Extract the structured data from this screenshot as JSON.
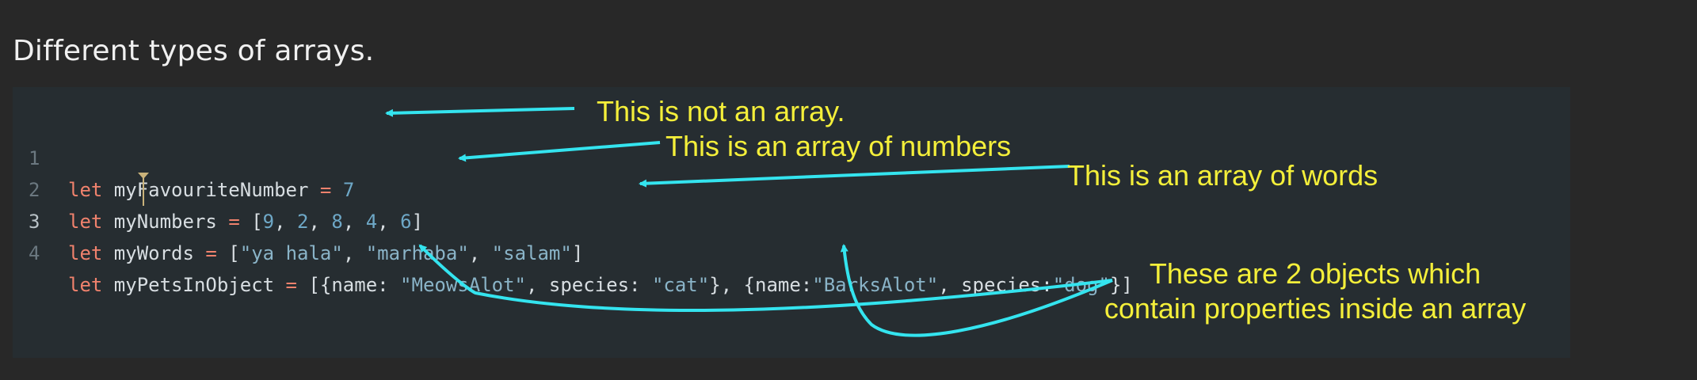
{
  "page": {
    "title": "Different types of arrays."
  },
  "code": {
    "lines": [
      {
        "number": "1",
        "tokens": [
          {
            "t": "let",
            "c": "kw"
          },
          {
            "t": " myFavouriteNumber ",
            "c": "plain"
          },
          {
            "t": "=",
            "c": "op"
          },
          {
            "t": " ",
            "c": "plain"
          },
          {
            "t": "7",
            "c": "num"
          }
        ]
      },
      {
        "number": "2",
        "tokens": [
          {
            "t": "let",
            "c": "kw"
          },
          {
            "t": " myNumbers ",
            "c": "plain"
          },
          {
            "t": "=",
            "c": "op"
          },
          {
            "t": " [",
            "c": "plain"
          },
          {
            "t": "9",
            "c": "num"
          },
          {
            "t": ", ",
            "c": "plain"
          },
          {
            "t": "2",
            "c": "num"
          },
          {
            "t": ", ",
            "c": "plain"
          },
          {
            "t": "8",
            "c": "num"
          },
          {
            "t": ", ",
            "c": "plain"
          },
          {
            "t": "4",
            "c": "num"
          },
          {
            "t": ", ",
            "c": "plain"
          },
          {
            "t": "6",
            "c": "num"
          },
          {
            "t": "]",
            "c": "plain"
          }
        ]
      },
      {
        "number": "3",
        "active": true,
        "tokens": [
          {
            "t": "let",
            "c": "kw"
          },
          {
            "t": " myWords ",
            "c": "plain"
          },
          {
            "t": "=",
            "c": "op"
          },
          {
            "t": " [",
            "c": "plain"
          },
          {
            "t": "\"ya hala\"",
            "c": "str"
          },
          {
            "t": ", ",
            "c": "plain"
          },
          {
            "t": "\"marhaba\"",
            "c": "str"
          },
          {
            "t": ", ",
            "c": "plain"
          },
          {
            "t": "\"salam\"",
            "c": "str"
          },
          {
            "t": "]",
            "c": "plain"
          }
        ]
      },
      {
        "number": "4",
        "tokens": [
          {
            "t": "let",
            "c": "kw"
          },
          {
            "t": " myPetsInObject ",
            "c": "plain"
          },
          {
            "t": "=",
            "c": "op"
          },
          {
            "t": " [{name: ",
            "c": "plain"
          },
          {
            "t": "\"MeowsAlot\"",
            "c": "str"
          },
          {
            "t": ", species: ",
            "c": "plain"
          },
          {
            "t": "\"cat\"",
            "c": "str"
          },
          {
            "t": "}, {name:",
            "c": "plain"
          },
          {
            "t": "\"BarksAlot\"",
            "c": "str"
          },
          {
            "t": ", species:",
            "c": "plain"
          },
          {
            "t": "\"dog\"",
            "c": "str"
          },
          {
            "t": "}]",
            "c": "plain"
          }
        ]
      }
    ]
  },
  "annotations": {
    "not_array": "This is not an array.",
    "array_numbers": "This is an array of numbers",
    "array_words": "This is an array of words",
    "objects_line1": "These are 2 objects which",
    "objects_line2": "contain properties inside an array"
  },
  "colors": {
    "background": "#282828",
    "code_panel": "#262d31",
    "annotation_text": "#f4ef3a",
    "arrow": "#34e4ef"
  }
}
